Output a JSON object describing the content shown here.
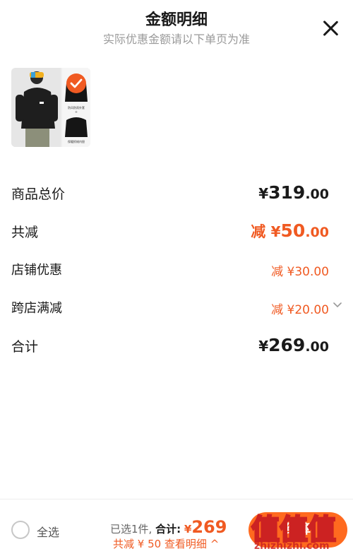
{
  "header": {
    "title": "金额明细",
    "subtitle": "实际优惠金额请以下单页为准"
  },
  "product": {
    "thumb_labels": [
      "防风防雨外套",
      "保暖抓绒内胆"
    ],
    "plus": "+"
  },
  "rows": [
    {
      "label": "商品总价",
      "prefix": "",
      "yen": "¥",
      "int": "319",
      "dec": ".00",
      "color": "#1a1a1a"
    },
    {
      "label": "共减",
      "prefix": "减 ",
      "yen": "¥",
      "int": "50",
      "dec": ".00",
      "color": "#f05a22"
    },
    {
      "label": "店铺优惠",
      "prefix": "减 ",
      "yen": "¥",
      "int": "30",
      "dec": ".00",
      "color": "#f05a22"
    },
    {
      "label": "跨店满减",
      "prefix": "减 ",
      "yen": "¥",
      "int": "20",
      "dec": ".00",
      "color": "#f05a22"
    },
    {
      "label": "合计",
      "prefix": "",
      "yen": "¥",
      "int": "269",
      "dec": ".00",
      "color": "#1a1a1a"
    }
  ],
  "footer": {
    "select_all": "全选",
    "selected_count": "已选1件,",
    "total_label": "合计:",
    "total_yen": "¥",
    "total_value": "269",
    "discount_text": "共减 ¥ 50 查看明细 ^",
    "checkout_label": "结算",
    "watermark": "zhizhizhi.com",
    "watermark_chars": "值值值"
  },
  "colors": {
    "accent": "#f05a22",
    "checkout": "#ff6a1f",
    "text": "#1a1a1a",
    "muted": "#9a9a9a"
  }
}
